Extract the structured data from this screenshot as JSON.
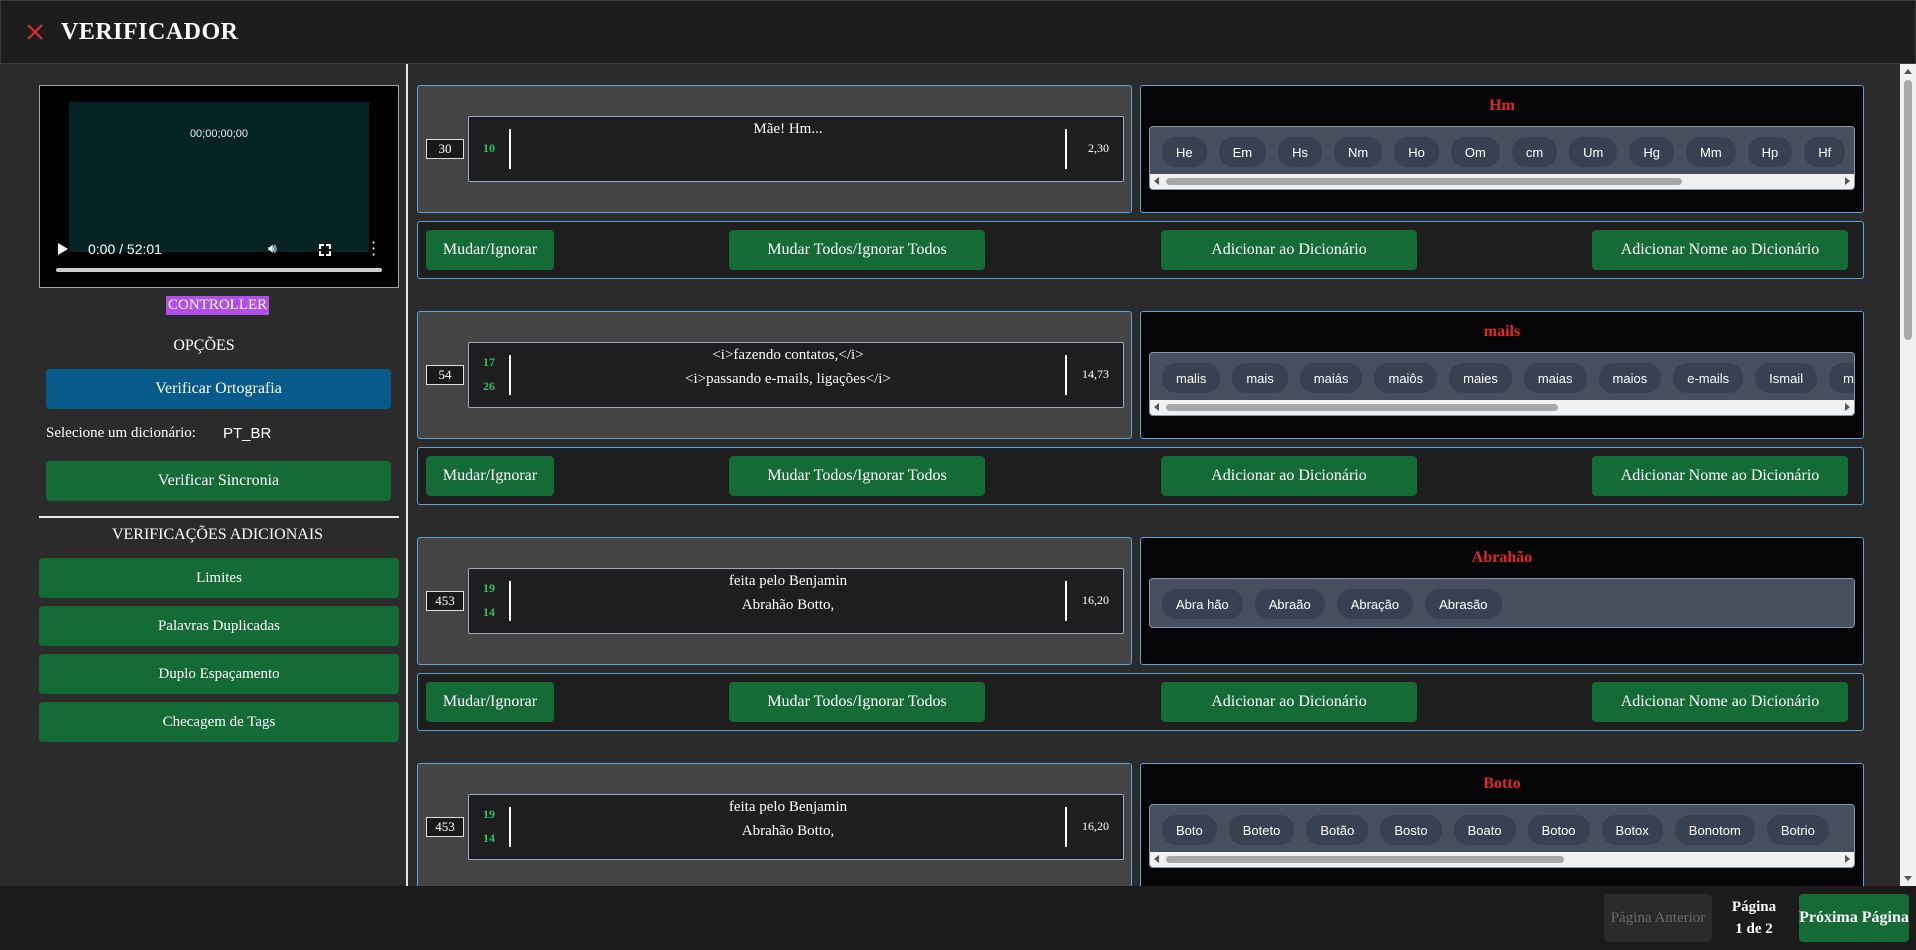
{
  "header": {
    "title": "VERIFICADOR",
    "close_icon": "close-icon",
    "accent": "#e03030"
  },
  "video": {
    "timecode": "00;00;00;00",
    "time": "0:00 / 52:01"
  },
  "sidebar": {
    "controller": "CONTROLLER",
    "options_title": "OPÇÕES",
    "spell_check": "Verificar Ortografia",
    "dict_label": "Selecione um dicionário:",
    "dict_value": "PT_BR",
    "sync_check": "Verificar Sincronia",
    "extra_title": "VERIFICAÇÕES ADICIONAIS",
    "checks": [
      "Limites",
      "Palavras Duplicadas",
      "Duplo Espaçamento",
      "Checagem de Tags"
    ]
  },
  "actions": {
    "change": "Mudar/Ignorar",
    "change_all": "Mudar Todos/Ignorar Todos",
    "add_dict": "Adicionar ao Dicionário",
    "add_name": "Adicionar Nome ao Dicionário"
  },
  "entries": [
    {
      "index": "30",
      "nums": [
        "10"
      ],
      "lines": [
        "Mãe! Hm..."
      ],
      "duration": "2,30",
      "word": "Hm",
      "suggestions": [
        "He",
        "Em",
        "Hs",
        "Nm",
        "Ho",
        "Om",
        "cm",
        "Um",
        "Hg",
        "Mm",
        "Hp",
        "Hf"
      ]
    },
    {
      "index": "54",
      "nums": [
        "17",
        "26"
      ],
      "lines": [
        "<i>fazendo contatos,</i>",
        "<i>passando e-mails, ligações</i>"
      ],
      "duration": "14,73",
      "word": "mails",
      "suggestions": [
        "malis",
        "mais",
        "maiás",
        "maiôs",
        "maies",
        "maias",
        "maios",
        "e-mails",
        "Ismail",
        "mail"
      ]
    },
    {
      "index": "453",
      "nums": [
        "19",
        "14"
      ],
      "lines": [
        "feita pelo Benjamin",
        "Abrahão Botto,"
      ],
      "duration": "16,20",
      "word": "Abrahão",
      "suggestions": [
        "Abra hão",
        "Abraão",
        "Abração",
        "Abrasão"
      ]
    },
    {
      "index": "453",
      "nums": [
        "19",
        "14"
      ],
      "lines": [
        "feita pelo Benjamin",
        "Abrahão Botto,"
      ],
      "duration": "16,20",
      "word": "Botto",
      "suggestions": [
        "Boto",
        "Boteto",
        "Botão",
        "Bosto",
        "Boato",
        "Botoo",
        "Botox",
        "Bonotom",
        "Botrio"
      ]
    }
  ],
  "footer": {
    "prev": "Página Anterior",
    "page_label": "Página",
    "page_count": "1 de 2",
    "next": "Próxima Página"
  }
}
